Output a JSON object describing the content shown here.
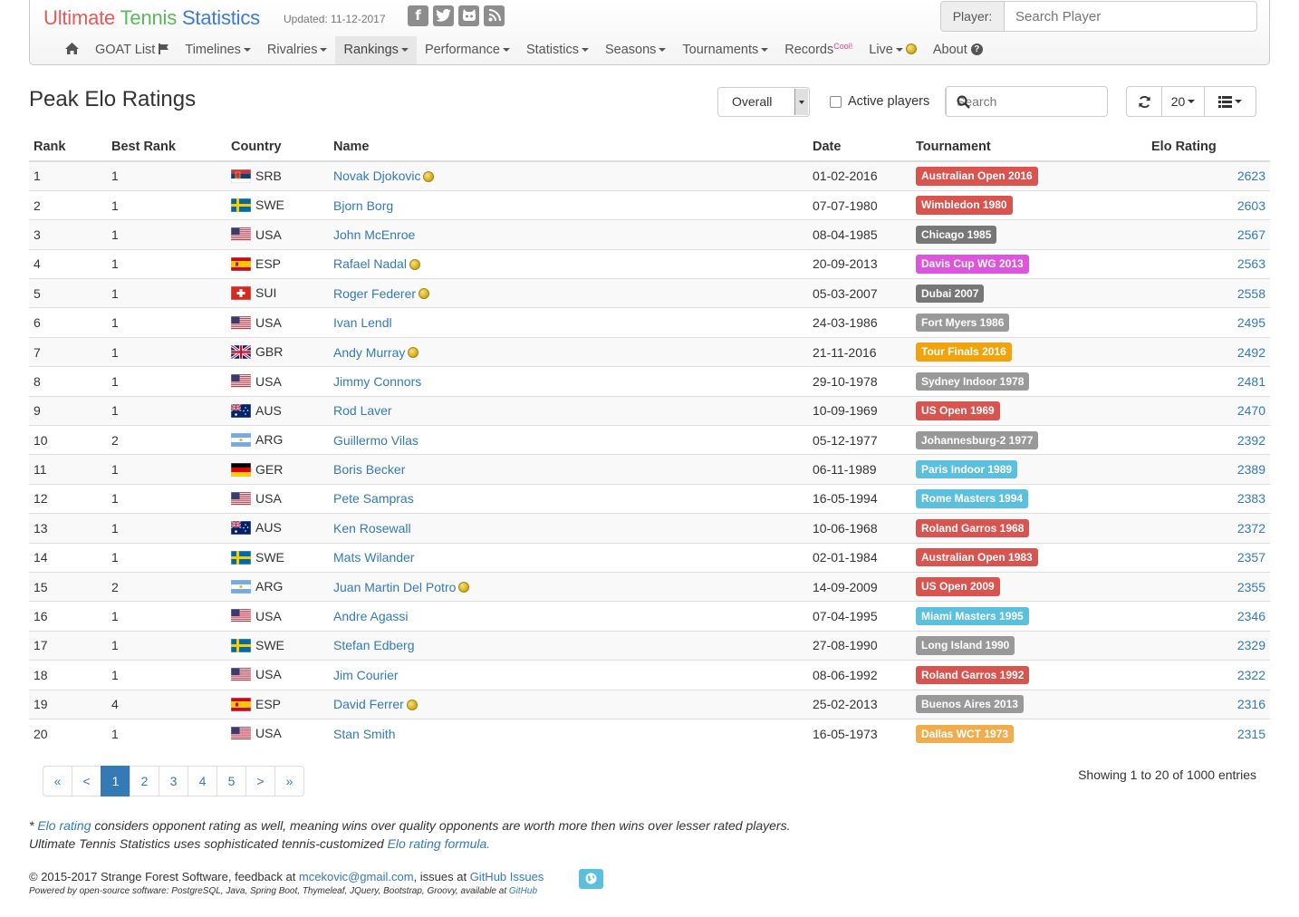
{
  "brand": {
    "word1": "Ultimate",
    "word2": "Tennis",
    "word3": "Statistics"
  },
  "updated": "Updated: 11-12-2017",
  "social_icons": [
    "facebook-icon",
    "twitter-icon",
    "github-icon",
    "rss-icon"
  ],
  "player_search": {
    "label": "Player:",
    "placeholder": "Search Player"
  },
  "menu": {
    "home_icon": "home-icon",
    "goat": "GOAT List",
    "timelines": "Timelines",
    "rivalries": "Rivalries",
    "rankings": "Rankings",
    "performance": "Performance",
    "statistics": "Statistics",
    "seasons": "Seasons",
    "tournaments": "Tournaments",
    "records": "Records",
    "records_badge": "Cool!",
    "live": "Live",
    "about": "About"
  },
  "page_title": "Peak Elo Ratings",
  "toolbar": {
    "surface_select": "Overall",
    "active_players_label": "Active players",
    "active_players_checked": false,
    "search_placeholder": "Search",
    "page_size": "20"
  },
  "table": {
    "headers": {
      "rank": "Rank",
      "best_rank": "Best Rank",
      "country": "Country",
      "name": "Name",
      "date": "Date",
      "tournament": "Tournament",
      "elo": "Elo Rating"
    },
    "rows": [
      {
        "rank": "1",
        "best_rank": "1",
        "country": "SRB",
        "name": "Novak Djokovic",
        "active": true,
        "date": "01-02-2016",
        "tournament": "Australian Open 2016",
        "level": "G",
        "elo": "2623"
      },
      {
        "rank": "2",
        "best_rank": "1",
        "country": "SWE",
        "name": "Bjorn Borg",
        "active": false,
        "date": "07-07-1980",
        "tournament": "Wimbledon 1980",
        "level": "G",
        "elo": "2603"
      },
      {
        "rank": "3",
        "best_rank": "1",
        "country": "USA",
        "name": "John McEnroe",
        "active": false,
        "date": "08-04-1985",
        "tournament": "Chicago 1985",
        "level": "A",
        "elo": "2567"
      },
      {
        "rank": "4",
        "best_rank": "1",
        "country": "ESP",
        "name": "Rafael Nadal",
        "active": true,
        "date": "20-09-2013",
        "tournament": "Davis Cup WG 2013",
        "level": "D",
        "elo": "2563"
      },
      {
        "rank": "5",
        "best_rank": "1",
        "country": "SUI",
        "name": "Roger Federer",
        "active": true,
        "date": "05-03-2007",
        "tournament": "Dubai 2007",
        "level": "A",
        "elo": "2558"
      },
      {
        "rank": "6",
        "best_rank": "1",
        "country": "USA",
        "name": "Ivan Lendl",
        "active": false,
        "date": "24-03-1986",
        "tournament": "Fort Myers 1986",
        "level": "B",
        "elo": "2495"
      },
      {
        "rank": "7",
        "best_rank": "1",
        "country": "GBR",
        "name": "Andy Murray",
        "active": true,
        "date": "21-11-2016",
        "tournament": "Tour Finals 2016",
        "level": "F",
        "elo": "2492"
      },
      {
        "rank": "8",
        "best_rank": "1",
        "country": "USA",
        "name": "Jimmy Connors",
        "active": false,
        "date": "29-10-1978",
        "tournament": "Sydney Indoor 1978",
        "level": "B",
        "elo": "2481"
      },
      {
        "rank": "9",
        "best_rank": "1",
        "country": "AUS",
        "name": "Rod Laver",
        "active": false,
        "date": "10-09-1969",
        "tournament": "US Open 1969",
        "level": "G",
        "elo": "2470"
      },
      {
        "rank": "10",
        "best_rank": "2",
        "country": "ARG",
        "name": "Guillermo Vilas",
        "active": false,
        "date": "05-12-1977",
        "tournament": "Johannesburg-2 1977",
        "level": "B",
        "elo": "2392"
      },
      {
        "rank": "11",
        "best_rank": "1",
        "country": "GER",
        "name": "Boris Becker",
        "active": false,
        "date": "06-11-1989",
        "tournament": "Paris Indoor 1989",
        "level": "M",
        "elo": "2389"
      },
      {
        "rank": "12",
        "best_rank": "1",
        "country": "USA",
        "name": "Pete Sampras",
        "active": false,
        "date": "16-05-1994",
        "tournament": "Rome Masters 1994",
        "level": "M",
        "elo": "2383"
      },
      {
        "rank": "13",
        "best_rank": "1",
        "country": "AUS",
        "name": "Ken Rosewall",
        "active": false,
        "date": "10-06-1968",
        "tournament": "Roland Garros 1968",
        "level": "G",
        "elo": "2372"
      },
      {
        "rank": "14",
        "best_rank": "1",
        "country": "SWE",
        "name": "Mats Wilander",
        "active": false,
        "date": "02-01-1984",
        "tournament": "Australian Open 1983",
        "level": "G",
        "elo": "2357"
      },
      {
        "rank": "15",
        "best_rank": "2",
        "country": "ARG",
        "name": "Juan Martin Del Potro",
        "active": true,
        "date": "14-09-2009",
        "tournament": "US Open 2009",
        "level": "G",
        "elo": "2355"
      },
      {
        "rank": "16",
        "best_rank": "1",
        "country": "USA",
        "name": "Andre Agassi",
        "active": false,
        "date": "07-04-1995",
        "tournament": "Miami Masters 1995",
        "level": "M",
        "elo": "2346"
      },
      {
        "rank": "17",
        "best_rank": "1",
        "country": "SWE",
        "name": "Stefan Edberg",
        "active": false,
        "date": "27-08-1990",
        "tournament": "Long Island 1990",
        "level": "B",
        "elo": "2329"
      },
      {
        "rank": "18",
        "best_rank": "1",
        "country": "USA",
        "name": "Jim Courier",
        "active": false,
        "date": "08-06-1992",
        "tournament": "Roland Garros 1992",
        "level": "G",
        "elo": "2322"
      },
      {
        "rank": "19",
        "best_rank": "4",
        "country": "ESP",
        "name": "David Ferrer",
        "active": true,
        "date": "25-02-2013",
        "tournament": "Buenos Aires 2013",
        "level": "B",
        "elo": "2316"
      },
      {
        "rank": "20",
        "best_rank": "1",
        "country": "USA",
        "name": "Stan Smith",
        "active": false,
        "date": "16-05-1973",
        "tournament": "Dallas WCT 1973",
        "level": "L",
        "elo": "2315"
      }
    ]
  },
  "badge_colors": {
    "G": "#d9534f",
    "A": "#777777",
    "D": "#dd55dd",
    "B": "#999999",
    "F": "#f0a30a",
    "M": "#5bc0de",
    "L": "#f0ad4e"
  },
  "pagination": {
    "first": "«",
    "prev": "<",
    "pages": [
      "1",
      "2",
      "3",
      "4",
      "5"
    ],
    "active": "1",
    "next": ">",
    "last": "»"
  },
  "showing": "Showing 1 to 20 of 1000 entries",
  "notes": {
    "line1_prefix": "* ",
    "line1_link": "Elo rating",
    "line1_text": " considers opponent rating as well, meaning wins over quality opponents are worth more then wins over lesser rated players.",
    "line2_text": "Ultimate Tennis Statistics uses sophisticated tennis-customized ",
    "line2_link": "Elo rating formula."
  },
  "footer": {
    "copyright": "© 2015-2017 Strange Forest Software, feedback at ",
    "email": "mcekovic@gmail.com",
    "issues_text": ", issues at ",
    "issues_link": "GitHub Issues",
    "powered": "Powered by open-source software: PostgreSQL, Java, Spring Boot, Thymeleaf, JQuery, Bootstrap, Groovy, available at ",
    "powered_link": "GitHub"
  }
}
